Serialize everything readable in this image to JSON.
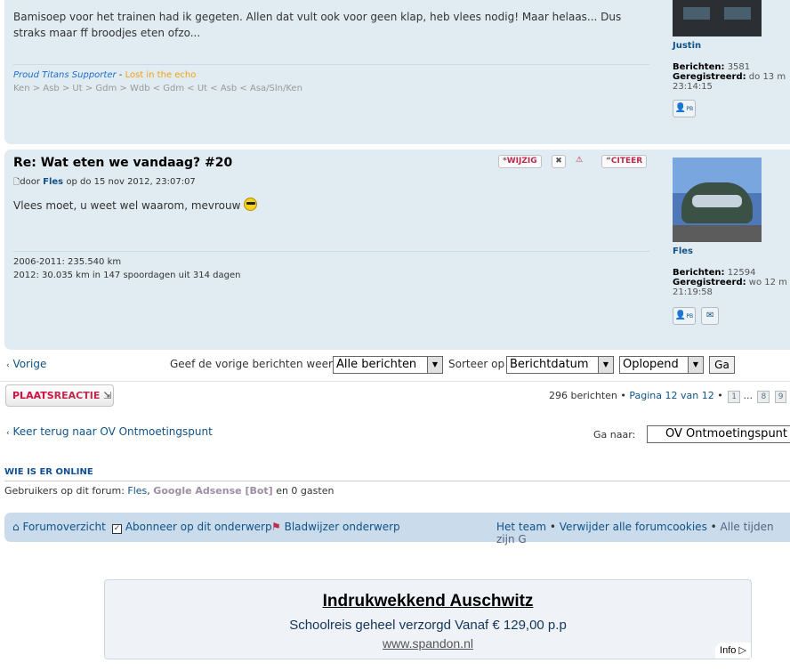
{
  "post1": {
    "content": "Bamisoep voor het trainen had ik gegeten. Allen dat vult ook voor geen klap, heb vlees nodig! Maar helaas... Dus straks maar ff broodjes eten ofzo...",
    "sig_line1_a": "Proud Titans Supporter",
    "sig_line1_sep": " - ",
    "sig_line1_b": "Lost in the echo",
    "sig_line2": "Ken > Asb > Ut > Gdm > Wdb < Gdm < Ut < Asb < Asa/Sln/Ken",
    "username": "Justin",
    "posts_label": "Berichten:",
    "posts_value": "3581",
    "registered_label": "Geregistreerd:",
    "registered_value": "do 13 m",
    "registered_time": "23:14:15",
    "pm_label": "PB"
  },
  "post2": {
    "title": "Re: Wat eten we vandaag? #20",
    "author_prefix": "door",
    "author": "Fles",
    "date": "op do 15 nov 2012, 23:07:07",
    "content": "Vlees moet, u weet wel waarom, mevrouw",
    "sig_line1": "2006-2011: 235.540 km",
    "sig_line2": "2012: 30.035 km in 147 spoordagen uit 314 dagen",
    "edit_label": "WIJZIG",
    "quote_label": "CITEER",
    "username": "Fles",
    "posts_label": "Berichten:",
    "posts_value": "12594",
    "registered_label": "Geregistreerd:",
    "registered_value": "wo 12 m",
    "registered_time": "21:19:58",
    "pm_label": "PB"
  },
  "sortbar": {
    "prev": "Vorige",
    "show_label": "Geef de vorige berichten weer:",
    "show_value": "Alle berichten",
    "sort_label": "Sorteer op",
    "sort_value": "Berichtdatum",
    "order_value": "Oplopend",
    "go": "Ga"
  },
  "pagination": {
    "reply_a": "PLAATS",
    "reply_b": "REACTIE",
    "summary": "296 berichten",
    "page": "Pagina 12 van 12",
    "p1": "1",
    "ellipsis": "...",
    "p8": "8",
    "p9": "9"
  },
  "jumpbar": {
    "back": "Keer terug naar OV Ontmoetingspunt",
    "goto_label": "Ga naar:",
    "goto_value": "OV Ontmoetingspunt"
  },
  "online": {
    "heading": "WIE IS ER ONLINE",
    "prefix": "Gebruikers op dit forum: ",
    "user1": "Fles",
    "sep": ", ",
    "user2": "Google Adsense [Bot]",
    "suffix": " en 0 gasten"
  },
  "navbar": {
    "forum_index": "Forumoverzicht",
    "subscribe": "Abonneer op dit onderwerp",
    "bookmark": "Bladwijzer onderwerp",
    "team": "Het team",
    "delete_cookies": "Verwijder alle forumcookies",
    "timezone": "Alle tijden zijn G"
  },
  "ad": {
    "title": "Indrukwekkend Auschwitz",
    "line": "Schoolreis geheel verzorgd Vanaf € 129,00 p.p",
    "url": "www.spandon.nl",
    "info": "Info"
  }
}
